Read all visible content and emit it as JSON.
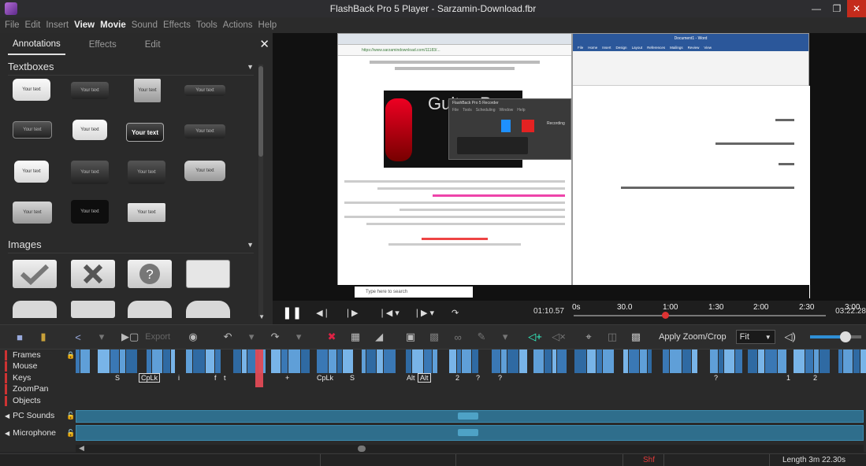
{
  "window": {
    "title": "FlashBack Pro 5 Player - Sarzamin-Download.fbr"
  },
  "menu": [
    "File",
    "Edit",
    "Insert",
    "View",
    "Movie",
    "Sound",
    "Effects",
    "Tools",
    "Actions",
    "Help"
  ],
  "panel": {
    "tabs": [
      "Annotations",
      "Effects",
      "Edit"
    ],
    "sections": {
      "textboxes": "Textboxes",
      "images": "Images"
    },
    "textbox_label": "Your text"
  },
  "video": {
    "browser_url": "https://www.sarzamindownload.com/11183/...",
    "guitar_brand": "Guitar Pro",
    "recorder_title": "FlashBack Pro 5 Recorder",
    "recorder_menu": [
      "File",
      "Tools",
      "Scheduling",
      "Window",
      "Help"
    ],
    "recorder_status": "Recording",
    "word_title": "Document1 - Word",
    "word_tabs": [
      "File",
      "Home",
      "Insert",
      "Design",
      "Layout",
      "References",
      "Mailings",
      "Review",
      "View"
    ],
    "taskbar_search": "Type here to search"
  },
  "playback": {
    "current": "01:10.57",
    "end": "03:22.28",
    "ticks": [
      "0s",
      "30.0",
      "1:00",
      "1:30",
      "2:00",
      "2:30",
      "3:00"
    ],
    "progress": 0.35
  },
  "toolbar": {
    "export": "Export",
    "apply_zoom": "Apply Zoom/Crop",
    "fit": "Fit",
    "volume": 0.7
  },
  "tracks": {
    "frames": "Frames",
    "mouse": "Mouse",
    "keys": "Keys",
    "zoompan": "ZoomPan",
    "objects": "Objects",
    "pc_sounds": "PC Sounds",
    "microphone": "Microphone"
  },
  "keys": [
    "S",
    "CpLk",
    "i",
    "f",
    "t",
    "+",
    "CpLk",
    "S",
    "Alt",
    "Alt",
    "2",
    "?",
    "?",
    "?",
    "1",
    "2"
  ],
  "status": {
    "shift": "Shf",
    "length": "Length 3m 22.30s"
  }
}
